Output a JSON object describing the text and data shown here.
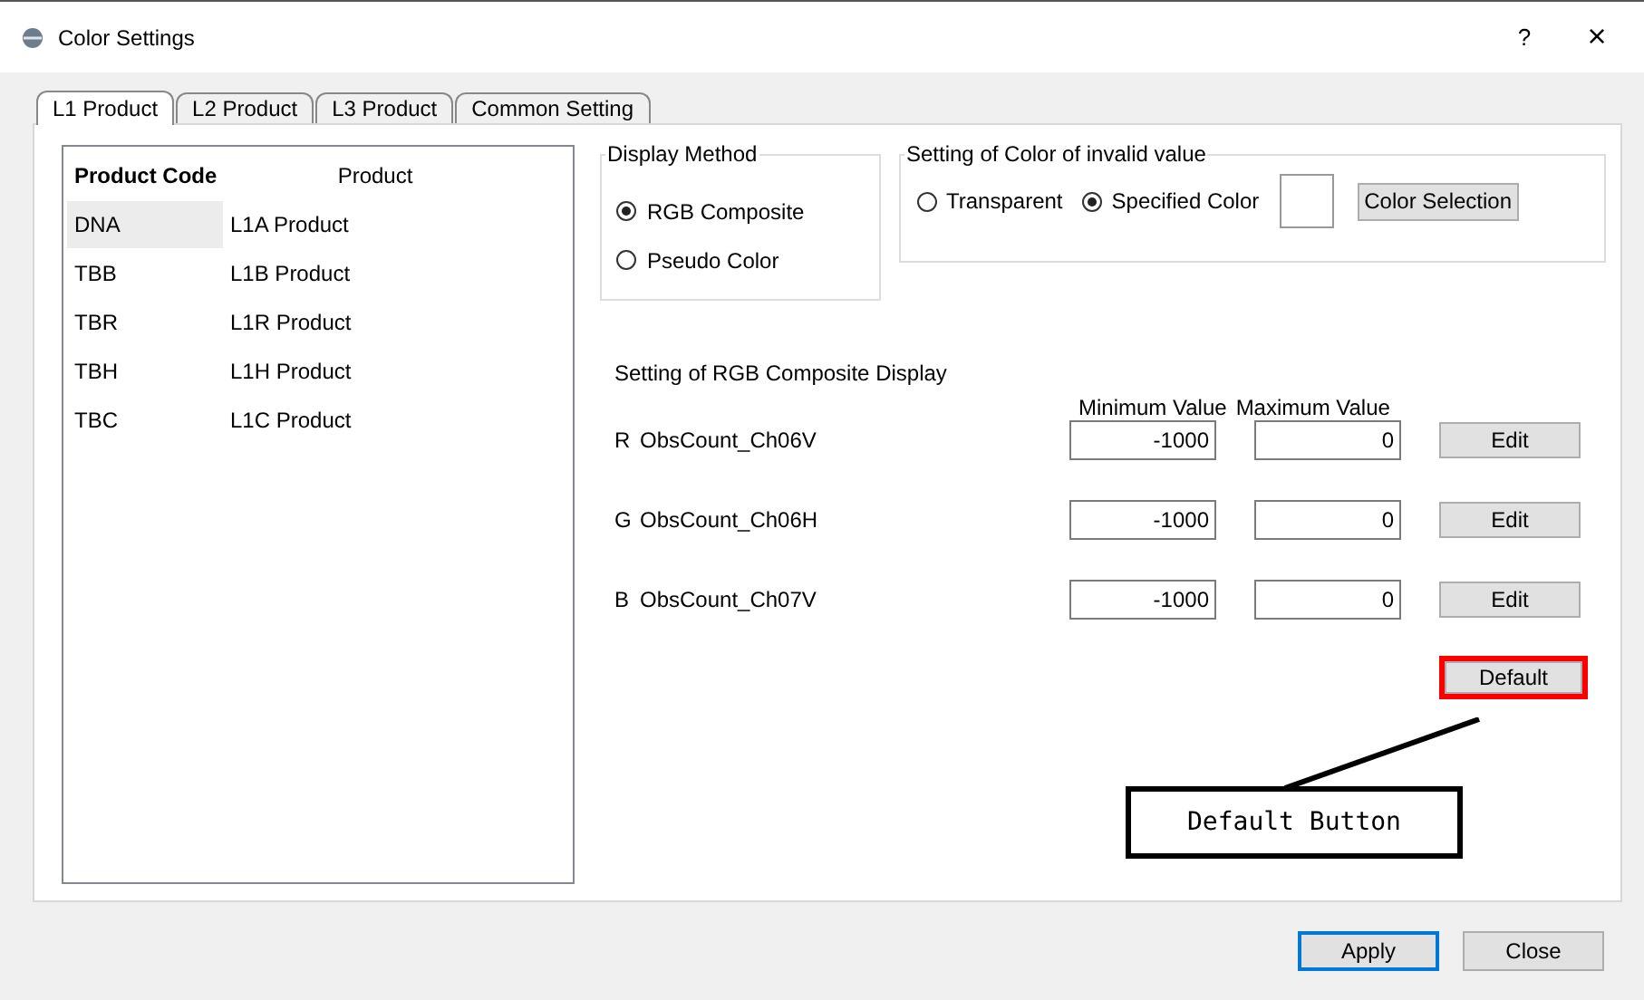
{
  "window": {
    "title": "Color Settings",
    "help": "?",
    "close": "×"
  },
  "tabs": [
    {
      "label": "L1 Product",
      "selected": true
    },
    {
      "label": "L2 Product",
      "selected": false
    },
    {
      "label": "L3 Product",
      "selected": false
    },
    {
      "label": "Common Setting",
      "selected": false
    }
  ],
  "product_table": {
    "columns": [
      "Product Code",
      "Product"
    ],
    "rows": [
      {
        "code": "DNA",
        "product": "L1A Product",
        "selected": true
      },
      {
        "code": "TBB",
        "product": "L1B Product",
        "selected": false
      },
      {
        "code": "TBR",
        "product": "L1R Product",
        "selected": false
      },
      {
        "code": "TBH",
        "product": "L1H Product",
        "selected": false
      },
      {
        "code": "TBC",
        "product": "L1C Product",
        "selected": false
      }
    ]
  },
  "display_method": {
    "legend": "Display Method",
    "options": [
      {
        "label": "RGB Composite",
        "selected": true
      },
      {
        "label": "Pseudo Color",
        "selected": false
      }
    ]
  },
  "invalid_value_color": {
    "legend": "Setting of Color of invalid value",
    "options": [
      {
        "label": "Transparent",
        "selected": false
      },
      {
        "label": "Specified Color",
        "selected": true
      }
    ],
    "button": "Color Selection"
  },
  "rgb_composite": {
    "title": "Setting of RGB Composite Display",
    "columns": [
      "Minimum Value",
      "Maximum Value"
    ],
    "channels": [
      {
        "letter": "R",
        "name": "ObsCount_Ch06V",
        "min": "-1000",
        "max": "0",
        "button": "Edit"
      },
      {
        "letter": "G",
        "name": "ObsCount_Ch06H",
        "min": "-1000",
        "max": "0",
        "button": "Edit"
      },
      {
        "letter": "B",
        "name": "ObsCount_Ch07V",
        "min": "-1000",
        "max": "0",
        "button": "Edit"
      }
    ],
    "default_button": "Default"
  },
  "annotation": {
    "text": "Default Button"
  },
  "footer": {
    "buttons": [
      {
        "label": "Apply",
        "default": true
      },
      {
        "label": "Close",
        "default": false
      }
    ]
  }
}
